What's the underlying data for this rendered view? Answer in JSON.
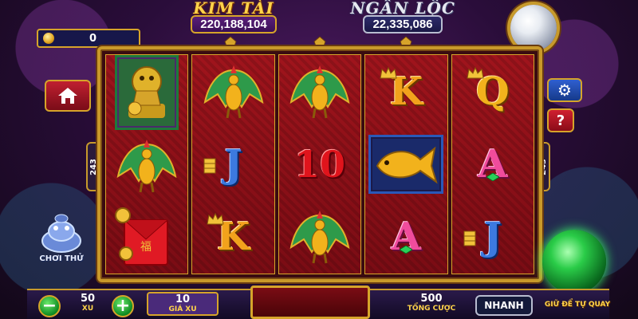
{
  "jackpots": {
    "kim_tai": {
      "title": "KIM TÀI",
      "value": "220,188,104"
    },
    "ngan_loc": {
      "title": "NGÂN LỘC",
      "value": "22,335,086"
    }
  },
  "balance": {
    "value": "0"
  },
  "ways": {
    "left": "243",
    "right": "243"
  },
  "reels": [
    [
      "lion",
      "peacock",
      "envelope"
    ],
    [
      "peacock",
      "J",
      "K"
    ],
    [
      "peacock",
      "10",
      "peacock"
    ],
    [
      "K",
      "koi",
      "A"
    ],
    [
      "Q",
      "A",
      "J"
    ]
  ],
  "controls": {
    "minus": "−",
    "plus": "+",
    "xu_value": "50",
    "xu_label": "XU",
    "gia_xu_value": "10",
    "gia_xu_label": "GIÁ XU",
    "tong_cuoc_value": "500",
    "tong_cuoc_label": "TỔNG CƯỢC",
    "nhanh_label": "NHANH",
    "auto_label": "GIỮ ĐỂ TỰ QUAY",
    "demo_label": "CHƠI THỬ"
  },
  "icons": {
    "home": "home-icon",
    "settings": "gear-icon",
    "help": "question-icon"
  },
  "colors": {
    "gold": "#d6a42a",
    "reel_red": "#a0141c",
    "purple_bg": "#2a0d3a"
  }
}
